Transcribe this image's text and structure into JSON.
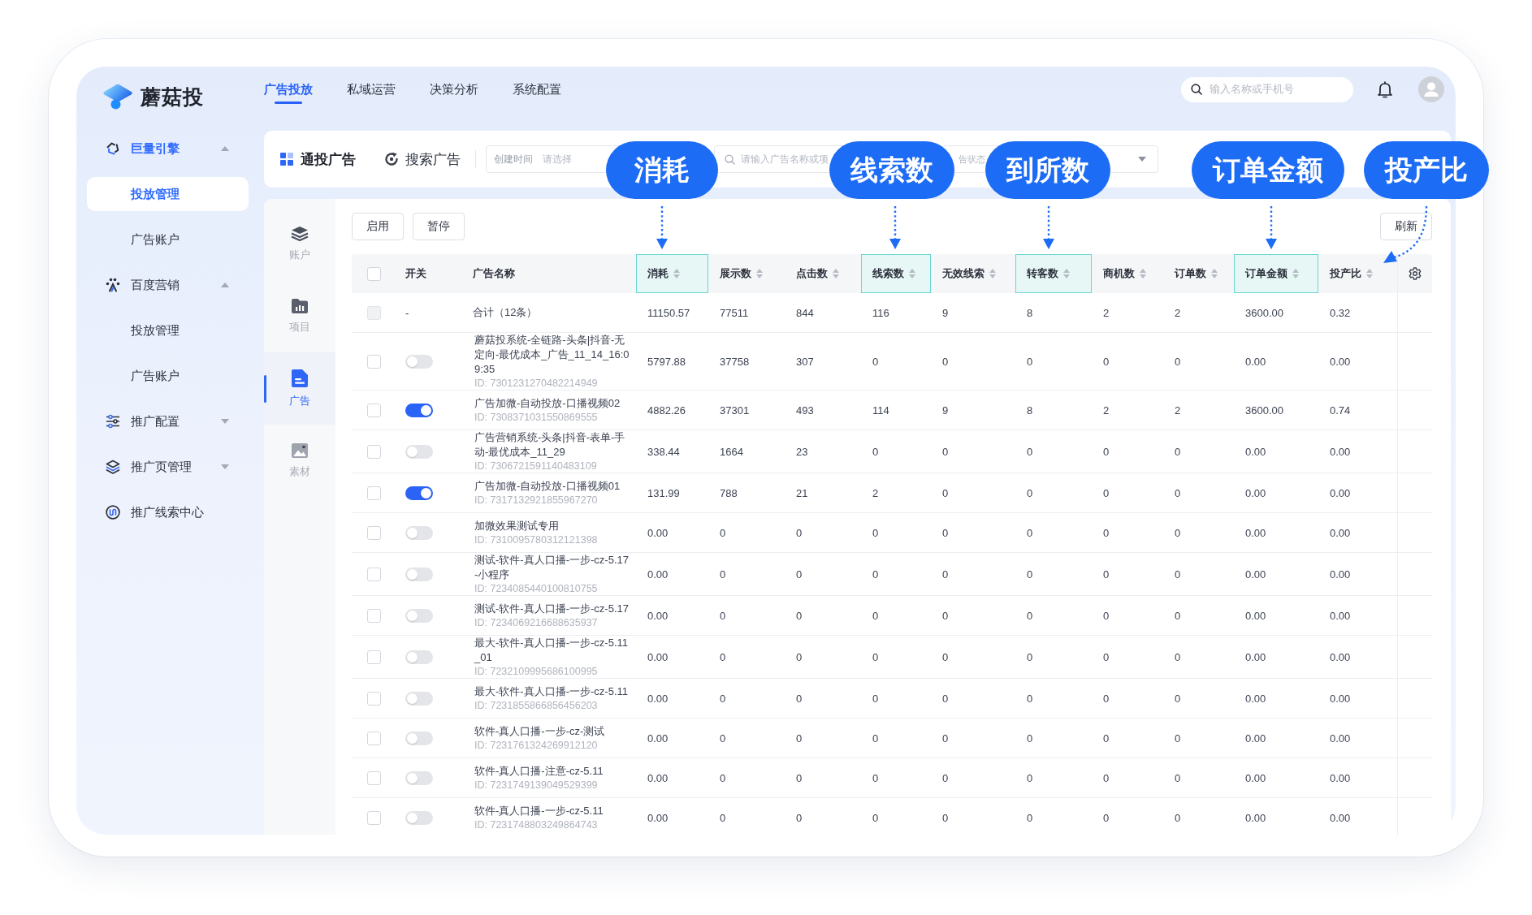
{
  "app": {
    "name": "蘑菇投"
  },
  "top_nav": {
    "tabs": [
      {
        "label": "广告投放",
        "selected": true
      },
      {
        "label": "私域运营",
        "selected": false
      },
      {
        "label": "决策分析",
        "selected": false
      },
      {
        "label": "系统配置",
        "selected": false
      }
    ],
    "search": {
      "placeholder": "输入名称或手机号"
    }
  },
  "sidebar": {
    "items": [
      {
        "kind": "group",
        "label": "巨量引擎",
        "active": true,
        "expanded": true,
        "children": [
          {
            "label": "投放管理",
            "selected": true
          },
          {
            "label": "广告账户",
            "selected": false
          }
        ]
      },
      {
        "kind": "group",
        "label": "百度营销",
        "active": false,
        "expanded": true,
        "children": [
          {
            "label": "投放管理",
            "selected": false
          },
          {
            "label": "广告账户",
            "selected": false
          }
        ]
      },
      {
        "kind": "group",
        "label": "推广配置",
        "active": false,
        "expanded": false
      },
      {
        "kind": "group",
        "label": "推广页管理",
        "active": false,
        "expanded": false
      },
      {
        "kind": "link",
        "label": "推广线索中心",
        "active": false
      }
    ]
  },
  "filter_bar": {
    "tabs": [
      {
        "label": "通投广告",
        "selected": true
      },
      {
        "label": "搜索广告",
        "selected": false
      }
    ],
    "date_field": {
      "label": "创建时间",
      "placeholder": "请选择"
    },
    "search_field": {
      "placeholder": "请输入广告名称或项"
    },
    "status_field": {
      "placeholder": "告状态"
    }
  },
  "rail": {
    "items": [
      {
        "label": "账户",
        "selected": false
      },
      {
        "label": "项目",
        "selected": false
      },
      {
        "label": "广告",
        "selected": true
      },
      {
        "label": "素材",
        "selected": false
      }
    ]
  },
  "toolbar": {
    "buttons": [
      "启用",
      "暂停"
    ],
    "refresh": "刷新"
  },
  "table": {
    "select_all": {
      "checked": false
    },
    "columns": [
      {
        "kind": "switch",
        "label": "开关",
        "sortable": false,
        "highlighted": false
      },
      {
        "kind": "name",
        "label": "广告名称",
        "sortable": false,
        "highlighted": false
      },
      {
        "kind": "metric",
        "label": "消耗",
        "sortable": true,
        "highlighted": true
      },
      {
        "kind": "metric",
        "label": "展示数",
        "sortable": true,
        "highlighted": false
      },
      {
        "kind": "metric",
        "label": "点击数",
        "sortable": true,
        "highlighted": false
      },
      {
        "kind": "metric",
        "label": "线索数",
        "sortable": true,
        "highlighted": true
      },
      {
        "kind": "metric",
        "label": "无效线索",
        "sortable": true,
        "highlighted": false
      },
      {
        "kind": "metric",
        "label": "转客数",
        "sortable": true,
        "highlighted": true
      },
      {
        "kind": "metric",
        "label": "商机数",
        "sortable": true,
        "highlighted": false
      },
      {
        "kind": "metric",
        "label": "订单数",
        "sortable": true,
        "highlighted": false
      },
      {
        "kind": "metric",
        "label": "订单金额",
        "sortable": true,
        "highlighted": true
      },
      {
        "kind": "metric",
        "label": "投产比",
        "sortable": true,
        "highlighted": false
      }
    ],
    "summary": {
      "checked": false,
      "disabled": true,
      "switch": "-",
      "name": "合计（12条）",
      "values": [
        "11150.57",
        "77511",
        "844",
        "116",
        "9",
        "8",
        "2",
        "2",
        "3600.00",
        "0.32"
      ]
    },
    "rows": [
      {
        "checked": false,
        "on": false,
        "name": "蘑菇投系统-全链路-头条|抖音-无定向-最优成本_广告_11_14_16:09:35",
        "id": "ID: 7301231270482214949",
        "values": [
          "5797.88",
          "37758",
          "307",
          "0",
          "0",
          "0",
          "0",
          "0",
          "0.00",
          "0.00"
        ]
      },
      {
        "checked": false,
        "on": true,
        "name": "广告加微-自动投放-口播视频02",
        "id": "ID: 7308371031550869555",
        "values": [
          "4882.26",
          "37301",
          "493",
          "114",
          "9",
          "8",
          "2",
          "2",
          "3600.00",
          "0.74"
        ]
      },
      {
        "checked": false,
        "on": false,
        "name": "广告营销系统-头条|抖音-表单-手动-最优成本_11_29",
        "id": "ID: 7306721591140483109",
        "values": [
          "338.44",
          "1664",
          "23",
          "0",
          "0",
          "0",
          "0",
          "0",
          "0.00",
          "0.00"
        ]
      },
      {
        "checked": false,
        "on": true,
        "name": "广告加微-自动投放-口播视频01",
        "id": "ID: 7317132921855967270",
        "values": [
          "131.99",
          "788",
          "21",
          "2",
          "0",
          "0",
          "0",
          "0",
          "0.00",
          "0.00"
        ]
      },
      {
        "checked": false,
        "on": false,
        "name": "加微效果测试专用",
        "id": "ID: 7310095780312121398",
        "values": [
          "0.00",
          "0",
          "0",
          "0",
          "0",
          "0",
          "0",
          "0",
          "0.00",
          "0.00"
        ]
      },
      {
        "checked": false,
        "on": false,
        "name": "测试-软件-真人口播-一步-cz-5.17-小程序",
        "id": "ID: 7234085440100810755",
        "values": [
          "0.00",
          "0",
          "0",
          "0",
          "0",
          "0",
          "0",
          "0",
          "0.00",
          "0.00"
        ]
      },
      {
        "checked": false,
        "on": false,
        "name": "测试-软件-真人口播-一步-cz-5.17",
        "id": "ID: 7234069216688635937",
        "values": [
          "0.00",
          "0",
          "0",
          "0",
          "0",
          "0",
          "0",
          "0",
          "0.00",
          "0.00"
        ]
      },
      {
        "checked": false,
        "on": false,
        "name": "最大-软件-真人口播-一步-cz-5.11_01",
        "id": "ID: 7232109995686100995",
        "values": [
          "0.00",
          "0",
          "0",
          "0",
          "0",
          "0",
          "0",
          "0",
          "0.00",
          "0.00"
        ]
      },
      {
        "checked": false,
        "on": false,
        "name": "最大-软件-真人口播-一步-cz-5.11",
        "id": "ID: 7231855866856456203",
        "values": [
          "0.00",
          "0",
          "0",
          "0",
          "0",
          "0",
          "0",
          "0",
          "0.00",
          "0.00"
        ]
      },
      {
        "checked": false,
        "on": false,
        "name": "软件-真人口播-一步-cz-测试",
        "id": "ID: 7231761324269912120",
        "values": [
          "0.00",
          "0",
          "0",
          "0",
          "0",
          "0",
          "0",
          "0",
          "0.00",
          "0.00"
        ]
      },
      {
        "checked": false,
        "on": false,
        "name": "软件-真人口播-注意-cz-5.11",
        "id": "ID: 7231749139049529399",
        "values": [
          "0.00",
          "0",
          "0",
          "0",
          "0",
          "0",
          "0",
          "0",
          "0.00",
          "0.00"
        ]
      },
      {
        "checked": false,
        "on": false,
        "name": "软件-真人口播-一步-cz-5.11",
        "id": "ID: 7231748803249864743",
        "values": [
          "0.00",
          "0",
          "0",
          "0",
          "0",
          "0",
          "0",
          "0",
          "0.00",
          "0.00"
        ]
      }
    ]
  },
  "callouts": [
    {
      "label": "消耗",
      "kind": "down"
    },
    {
      "label": "线索数",
      "kind": "down"
    },
    {
      "label": "到所数",
      "kind": "down"
    },
    {
      "label": "订单金额",
      "kind": "down"
    },
    {
      "label": "投产比",
      "kind": "curved"
    }
  ]
}
